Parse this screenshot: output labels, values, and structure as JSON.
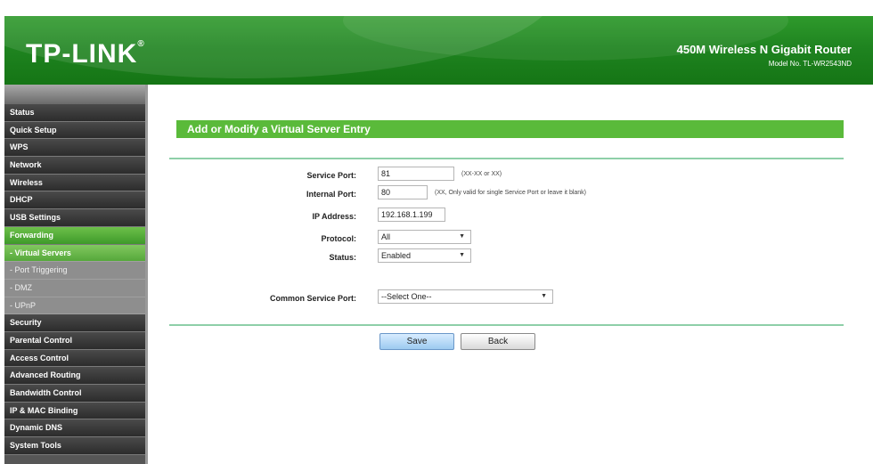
{
  "header": {
    "logo": "TP-LINK",
    "logo_mark": "®",
    "product_name": "450M Wireless N Gigabit Router",
    "model": "Model No. TL-WR2543ND"
  },
  "sidebar": {
    "items": [
      {
        "label": "Status"
      },
      {
        "label": "Quick Setup"
      },
      {
        "label": "WPS"
      },
      {
        "label": "Network"
      },
      {
        "label": "Wireless"
      },
      {
        "label": "DHCP"
      },
      {
        "label": "USB Settings"
      },
      {
        "label": "Forwarding"
      },
      {
        "label": "- Virtual Servers"
      },
      {
        "label": "- Port Triggering"
      },
      {
        "label": "- DMZ"
      },
      {
        "label": "- UPnP"
      },
      {
        "label": "Security"
      },
      {
        "label": "Parental Control"
      },
      {
        "label": "Access Control"
      },
      {
        "label": "Advanced Routing"
      },
      {
        "label": "Bandwidth Control"
      },
      {
        "label": "IP & MAC Binding"
      },
      {
        "label": "Dynamic DNS"
      },
      {
        "label": "System Tools"
      }
    ]
  },
  "form": {
    "title": "Add or Modify a Virtual Server Entry",
    "service_port": {
      "label": "Service Port:",
      "value": "81",
      "hint": "(XX-XX or XX)"
    },
    "internal_port": {
      "label": "Internal Port:",
      "value": "80",
      "hint": "(XX, Only valid for single Service Port or leave it blank)"
    },
    "ip_address": {
      "label": "IP Address:",
      "value": "192.168.1.199"
    },
    "protocol": {
      "label": "Protocol:",
      "value": "All"
    },
    "status": {
      "label": "Status:",
      "value": "Enabled"
    },
    "common_service_port": {
      "label": "Common Service Port:",
      "value": "--Select One--"
    },
    "save_label": "Save",
    "back_label": "Back"
  },
  "colors": {
    "header_green": "#1f8420",
    "section_green": "#5aba3a",
    "sidebar_dark": "#2c2c2c",
    "sidebar_active": "#3e9a2a"
  },
  "icons": {
    "dropdown": "chevron-down-icon"
  }
}
